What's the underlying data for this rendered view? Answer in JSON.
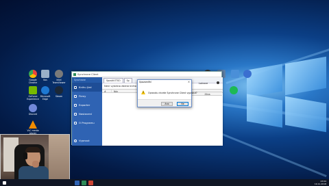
{
  "desktop_icons": [
    {
      "label": "Google\nChrome",
      "icon": "chrome-icon",
      "color": "#e8453c"
    },
    {
      "label": "Kos",
      "icon": "recycle-bin-icon",
      "color": "#9ab0c8"
    },
    {
      "label": "Intel\nTeamViewer",
      "icon": "teamviewer-icon",
      "color": "#7a7a7a"
    },
    {
      "label": "GeForce\nExperience",
      "icon": "geforce-icon",
      "color": "#76b900"
    },
    {
      "label": "Microsoft\nEdge",
      "icon": "edge-icon",
      "color": "#1e78d2"
    },
    {
      "label": "Steam",
      "icon": "steam-icon",
      "color": "#1b2838"
    },
    {
      "label": "Discord",
      "icon": "discord-icon",
      "color": "#7289da"
    },
    {
      "label": "VLC media\nplayer",
      "icon": "vlc-icon",
      "color": "#f08c00"
    }
  ],
  "app": {
    "title": "Synchrone Client",
    "sidebar_brand": "Synchrone",
    "sidebar_items": [
      {
        "label": "Knihu jízd",
        "icon": "book-icon"
      },
      {
        "label": "Firmy",
        "icon": "building-icon"
      },
      {
        "label": "Exporter",
        "icon": "export-icon"
      },
      {
        "label": "Nastavení",
        "icon": "gear-icon"
      },
      {
        "label": "O Programu",
        "icon": "info-icon"
      },
      {
        "label": "Vypnout",
        "icon": "power-icon"
      }
    ],
    "tabs": [
      "Spustit ETSO",
      "Sp"
    ],
    "heading": "Není vybrána žádná kniha",
    "grid_columns": [
      "#",
      "Náz"
    ],
    "right_panel_title": "Lokace",
    "right_columns": [
      "Datum",
      "Zóna"
    ]
  },
  "dialog": {
    "title": "Upozornění",
    "message": "Opravdu chcete Synchrone Client vypnout?",
    "yes_label": "Ano",
    "no_label": "Ne",
    "close_glyph": "✕"
  },
  "taskbar": {
    "time": "13:04",
    "date": "19.11.2018",
    "accent": "#101624"
  }
}
